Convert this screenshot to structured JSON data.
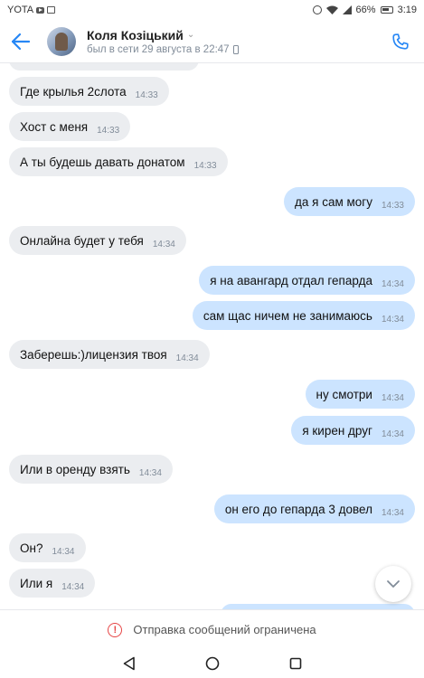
{
  "status_bar": {
    "carrier": "YOTA",
    "battery": "66%",
    "time": "3:19"
  },
  "header": {
    "name": "Коля Козіцький",
    "status": "был в сети 29 августа в 22:47"
  },
  "messages": [
    {
      "dir": "in",
      "text": "Где крылья 2слота",
      "time": "14:33"
    },
    {
      "dir": "in",
      "text": "Хост с меня",
      "time": "14:33"
    },
    {
      "dir": "in",
      "text": "А ты будешь давать донатом",
      "time": "14:33"
    },
    {
      "dir": "out",
      "text": "да я сам могу",
      "time": "14:33"
    },
    {
      "dir": "in",
      "text": "Онлайна будет у тебя",
      "time": "14:34"
    },
    {
      "dir": "out",
      "text": "я на авангард отдал гепарда",
      "time": "14:34"
    },
    {
      "dir": "out",
      "text": "сам щас ничем не занимаюсь",
      "time": "14:34"
    },
    {
      "dir": "in",
      "text": "Заберешь:)лицензия твоя",
      "time": "14:34"
    },
    {
      "dir": "out",
      "text": "ну смотри",
      "time": "14:34"
    },
    {
      "dir": "out",
      "text": "я кирен друг",
      "time": "14:34"
    },
    {
      "dir": "in",
      "text": "Или в оренду взять",
      "time": "14:34"
    },
    {
      "dir": "out",
      "text": "он его до гепарда 3 довел",
      "time": "14:34"
    },
    {
      "dir": "in",
      "text": "Он?",
      "time": "14:34"
    },
    {
      "dir": "in",
      "text": "Или я",
      "time": "14:34"
    }
  ],
  "footer": {
    "restricted_text": "Отправка сообщений ограничена"
  },
  "colors": {
    "accent": "#2787f5",
    "incoming_bubble": "#ebedf0",
    "outgoing_bubble": "#cce4ff",
    "warning": "#e64646"
  }
}
